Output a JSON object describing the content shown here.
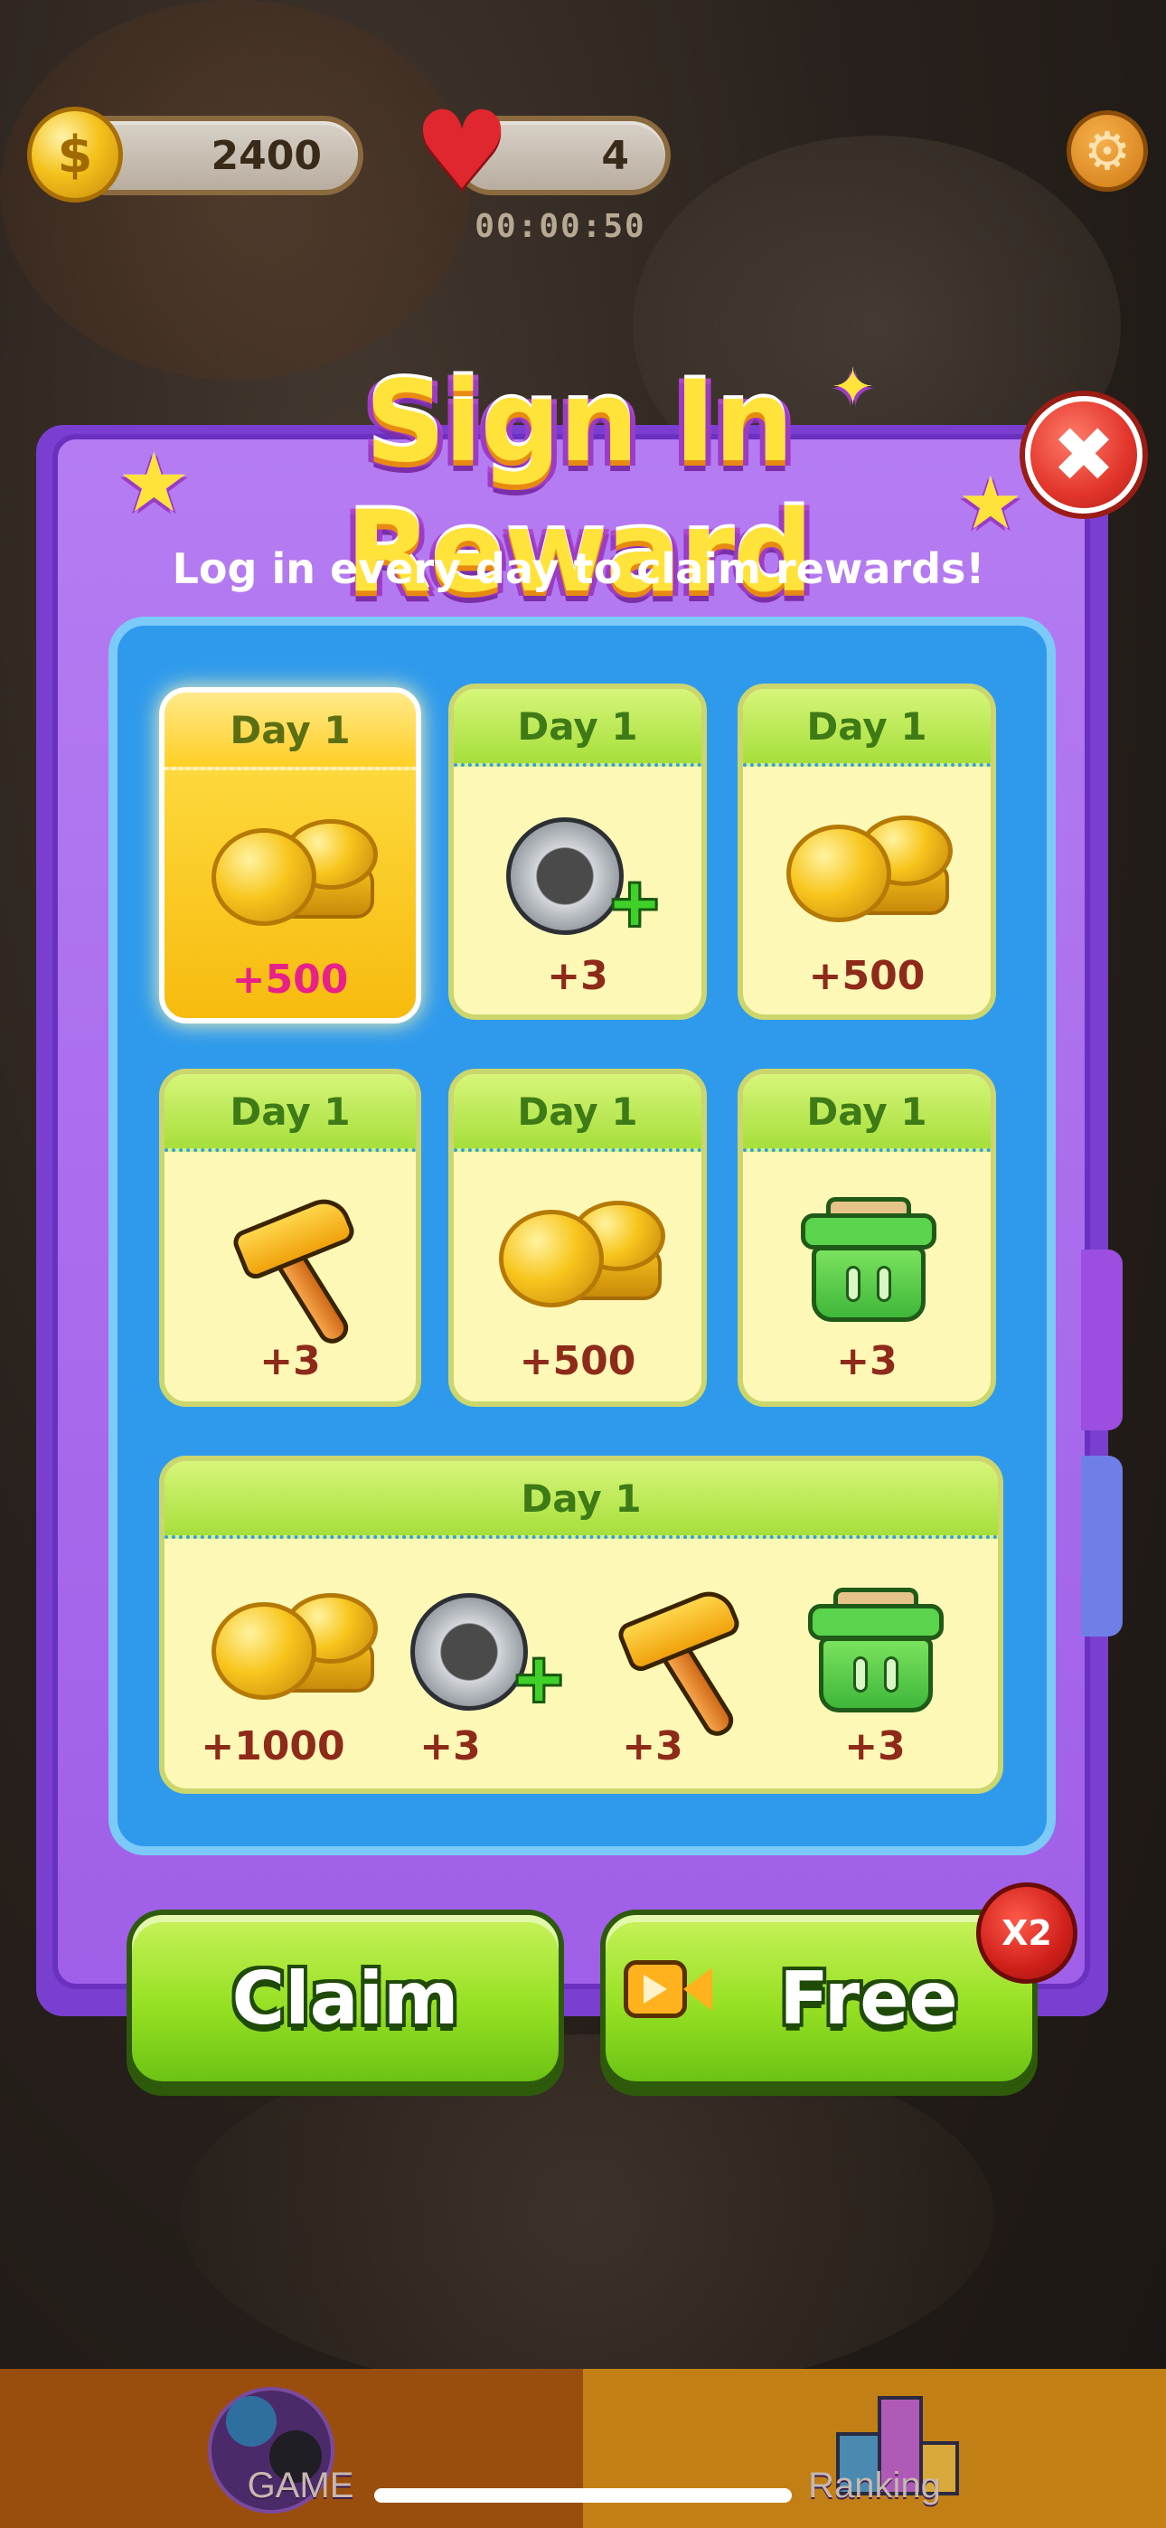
{
  "hud": {
    "coins": "2400",
    "lives": "4",
    "timer": "00:00:50",
    "settings_icon": "gear-icon"
  },
  "dialog": {
    "title": "Sign In Reward",
    "subtitle": "Log in every day to claim rewards!",
    "close_icon": "close-icon"
  },
  "rewards": [
    {
      "day": "Day 1",
      "icon": "coins-icon",
      "amount": "+500",
      "selected": true
    },
    {
      "day": "Day 1",
      "icon": "magnet-plus-icon",
      "amount": "+3",
      "selected": false
    },
    {
      "day": "Day 1",
      "icon": "coins-icon",
      "amount": "+500",
      "selected": false
    },
    {
      "day": "Day 1",
      "icon": "hammer-icon",
      "amount": "+3",
      "selected": false
    },
    {
      "day": "Day 1",
      "icon": "coins-icon",
      "amount": "+500",
      "selected": false
    },
    {
      "day": "Day 1",
      "icon": "basket-icon",
      "amount": "+3",
      "selected": false
    }
  ],
  "big_reward": {
    "day": "Day 1",
    "items": [
      {
        "icon": "coins-icon",
        "amount": "+1000"
      },
      {
        "icon": "magnet-plus-icon",
        "amount": "+3"
      },
      {
        "icon": "hammer-icon",
        "amount": "+3"
      },
      {
        "icon": "basket-icon",
        "amount": "+3"
      }
    ]
  },
  "buttons": {
    "claim": "Claim",
    "free": "Free",
    "multiplier": "X2",
    "video_icon": "video-camera-icon"
  },
  "nav": {
    "tabs": [
      {
        "label": "GAME",
        "icon": "game-balls-icon"
      },
      {
        "label": "Ranking",
        "icon": "ranking-trophy-icon"
      }
    ]
  },
  "colors": {
    "panel_purple": "#a76bee",
    "inner_blue": "#2f9aec",
    "button_green": "#96e023",
    "title_yellow": "#ffe33a"
  }
}
